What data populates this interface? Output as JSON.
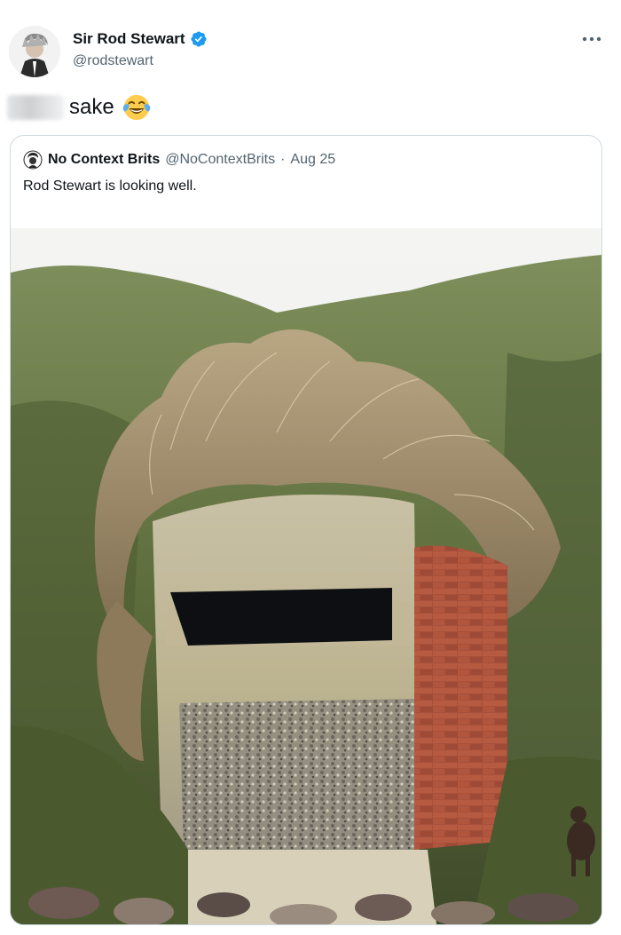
{
  "tweet": {
    "author_name": "Sir Rod Stewart",
    "author_handle": "@rodstewart",
    "text": "sake",
    "more_label": "More"
  },
  "quoted": {
    "author_name": "No Context Brits",
    "author_handle": "@NoContextBrits",
    "separator": "·",
    "date": "Aug 25",
    "text": "Rod Stewart is looking well."
  },
  "icons": {
    "verified": "verified-badge-icon",
    "more": "more-dots-icon",
    "emoji": "face-with-tears-of-joy-icon"
  },
  "colors": {
    "verified": "#1d9bf0",
    "secondary_text": "#536471",
    "border": "#cfd9de"
  }
}
